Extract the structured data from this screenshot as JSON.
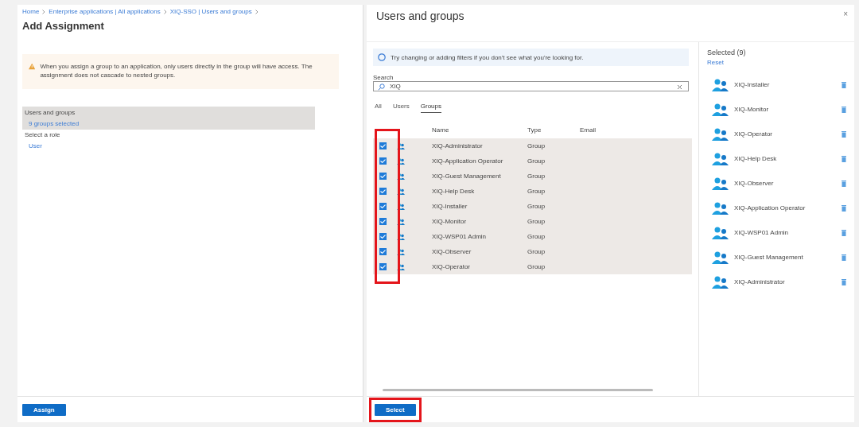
{
  "breadcrumb": [
    "Home",
    "Enterprise applications | All applications",
    "XIQ-SSO | Users and groups"
  ],
  "page": {
    "title": "Add Assignment",
    "warning": "When you assign a group to an application, only users directly in the group will have access. The assignment does not cascade to nested groups.",
    "sections": [
      {
        "label": "Users and groups",
        "value": "9 groups selected",
        "selected": true
      },
      {
        "label": "Select a role",
        "value": "User",
        "selected": false
      }
    ],
    "assign_button": "Assign"
  },
  "dialog": {
    "title": "Users and groups",
    "close": "×",
    "info": "Try changing or adding filters if you don't see what you're looking for.",
    "search": {
      "label": "Search",
      "value": "XIQ"
    },
    "tabs": [
      {
        "label": "All",
        "selected": false
      },
      {
        "label": "Users",
        "selected": false
      },
      {
        "label": "Groups",
        "selected": true
      }
    ],
    "columns": [
      "Name",
      "Type",
      "Email"
    ],
    "rows": [
      {
        "name": "XIQ-Administrator",
        "type": "Group",
        "checked": true
      },
      {
        "name": "XIQ-Application Operator",
        "type": "Group",
        "checked": true
      },
      {
        "name": "XIQ-Guest Management",
        "type": "Group",
        "checked": true
      },
      {
        "name": "XIQ-Help Desk",
        "type": "Group",
        "checked": true
      },
      {
        "name": "XIQ-Installer",
        "type": "Group",
        "checked": true
      },
      {
        "name": "XIQ-Monitor",
        "type": "Group",
        "checked": true
      },
      {
        "name": "XIQ-WSP01 Admin",
        "type": "Group",
        "checked": true
      },
      {
        "name": "XIQ-Observer",
        "type": "Group",
        "checked": true
      },
      {
        "name": "XIQ-Operator",
        "type": "Group",
        "checked": true
      }
    ],
    "selected_title": "Selected (9)",
    "reset": "Reset",
    "selected": [
      "XIQ-Installer",
      "XIQ-Monitor",
      "XIQ-Operator",
      "XIQ-Help Desk",
      "XIQ-Observer",
      "XIQ-Application Operator",
      "XIQ-WSP01 Admin",
      "XIQ-Guest Management",
      "XIQ-Administrator"
    ],
    "select_button": "Select"
  }
}
